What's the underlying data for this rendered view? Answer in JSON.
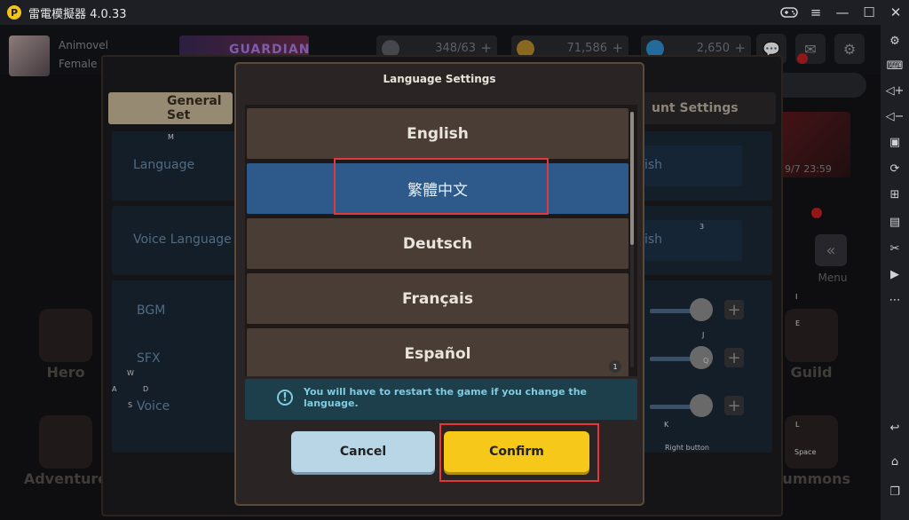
{
  "window": {
    "title": "雷電模擬器 4.0.33",
    "logo_glyph": "P"
  },
  "titlebar_icons": [
    "gamepad-icon",
    "menu-icon",
    "minimize-icon",
    "maximize-icon",
    "close-icon"
  ],
  "sidebar_icons": [
    "settings-icon",
    "keyboard-icon",
    "volume-up-icon",
    "volume-down-icon",
    "screen-record-icon",
    "rotate-icon",
    "add-app-icon",
    "apk-icon",
    "scissors-icon",
    "video-icon",
    "more-icon",
    "back-icon",
    "home-icon",
    "recent-apps-icon"
  ],
  "player": {
    "name": "Animovel",
    "gender": "Female"
  },
  "banner": {
    "text": "GUARDIAN"
  },
  "resources": [
    {
      "value": "348/63",
      "plus": "+",
      "color": "#6a6d74"
    },
    {
      "value": "71,586",
      "plus": "+",
      "color": "#b78a2a"
    },
    {
      "value": "2,650",
      "plus": "+",
      "color": "#2f8fd0"
    }
  ],
  "event": {
    "timestamp": "9/7 23:59"
  },
  "nav": {
    "hero": "Hero",
    "adventure": "Adventure",
    "guild": "Guild",
    "summons": "Summons",
    "menu": "Menu"
  },
  "settings": {
    "tab_general": "General Set",
    "tab_account": "unt Settings",
    "language_label": "Language",
    "language_value": "ish",
    "voice_label": "Voice Language",
    "voice_value": "ish",
    "bgm_label": "BGM",
    "sfx_label": "SFX",
    "voice_vol_label": "Voice",
    "levels": {
      "bgm": 0.85,
      "sfx": 0.85,
      "voice": 0.85
    }
  },
  "keymap": {
    "m": "M",
    "three": "3",
    "two": "2",
    "one": "1",
    "i": "I",
    "e": "E",
    "j": "J",
    "q": "Q",
    "w": "W",
    "a": "A",
    "d": "D",
    "s": "S",
    "k": "K",
    "l": "L",
    "right_button": "Right button",
    "space": "Space"
  },
  "modal": {
    "title": "Language Settings",
    "languages": [
      "English",
      "繁體中文",
      "Deutsch",
      "Français",
      "Español"
    ],
    "selected": "繁體中文",
    "notice_icon": "!",
    "notice": "You will have to restart the game if you change the language.",
    "cancel": "Cancel",
    "confirm": "Confirm"
  },
  "colors": {
    "accent_confirm": "#f6c81a",
    "selected_row": "#2d5a8a",
    "highlight": "#e2373b"
  }
}
